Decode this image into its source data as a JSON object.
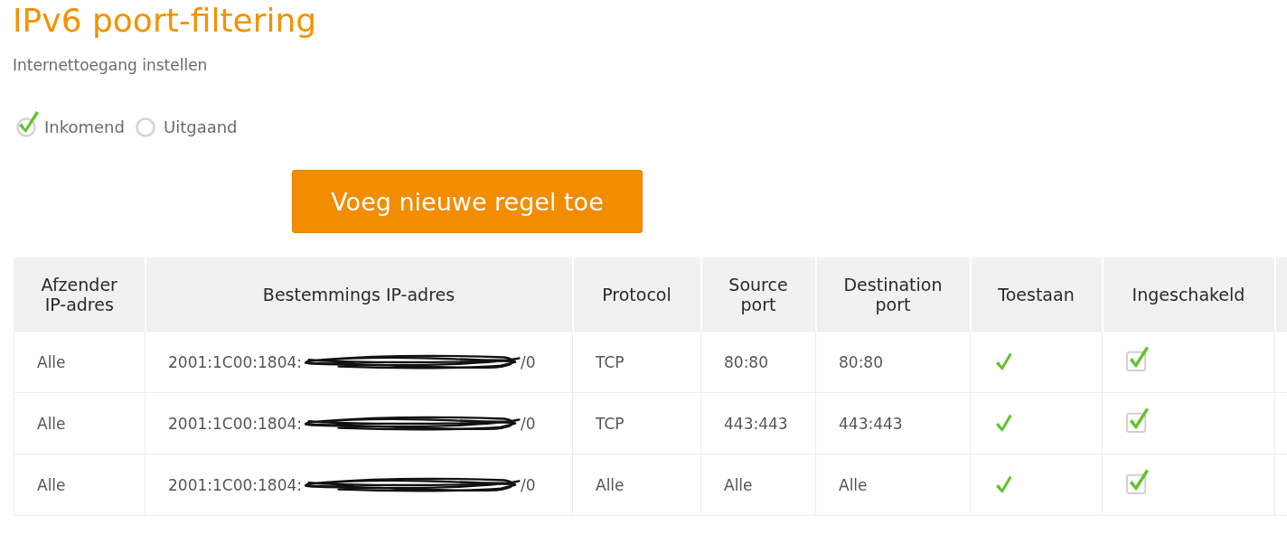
{
  "title": "IPv6 poort-filtering",
  "subtitle": "Internettoegang instellen",
  "direction": [
    {
      "label": "Inkomend",
      "selected": true
    },
    {
      "label": "Uitgaand",
      "selected": false
    }
  ],
  "add_button": {
    "label": "Voeg nieuwe regel toe"
  },
  "table": {
    "columns": [
      "Afzender IP-adres",
      "Bestemmings IP-adres",
      "Protocol",
      "Source port",
      "Destination port",
      "Toestaan",
      "Ingeschakeld"
    ],
    "rows": [
      {
        "source_ip": "Alle",
        "destination_ip": {
          "start": "2001:1C00:1804:",
          "end": "/0",
          "redacted": true
        },
        "protocol": "TCP",
        "source_port": "80:80",
        "destination_port": "80:80",
        "allowed": true,
        "enabled": true
      },
      {
        "source_ip": "Alle",
        "destination_ip": {
          "start": "2001:1C00:1804:",
          "end": "/0",
          "redacted": true
        },
        "protocol": "TCP",
        "source_port": "443:443",
        "destination_port": "443:443",
        "allowed": true,
        "enabled": true
      },
      {
        "source_ip": "Alle",
        "destination_ip": {
          "start": "2001:1C00:1804:",
          "end": "/0",
          "redacted": true
        },
        "protocol": "Alle",
        "source_port": "Alle",
        "destination_port": "Alle",
        "allowed": true,
        "enabled": true
      }
    ]
  }
}
